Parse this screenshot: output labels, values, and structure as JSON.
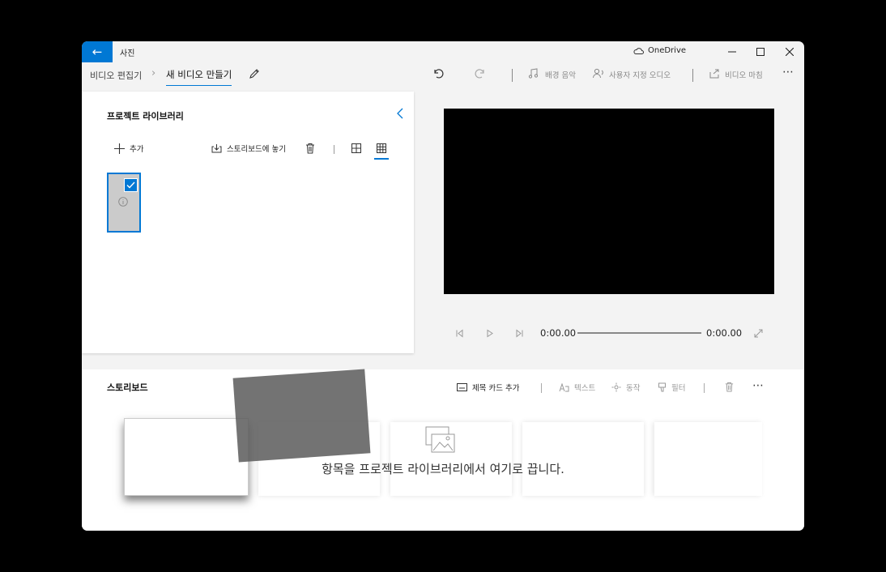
{
  "app": {
    "title": "사진",
    "onedrive_label": "OneDrive"
  },
  "icons": {
    "back": "back-arrow-icon",
    "onedrive": "cloud-icon",
    "minimize": "minimize-icon",
    "maximize": "maximize-icon",
    "close": "close-icon",
    "edit": "pencil-icon",
    "undo": "undo-icon",
    "redo": "redo-icon",
    "music": "music-note-icon",
    "custom_audio": "person-audio-icon",
    "finish": "share-icon",
    "more": "more-icon"
  },
  "breadcrumb": {
    "parent": "비디오 편집기",
    "current": "새 비디오 만들기"
  },
  "toolbar": {
    "background_music": "배경 음악",
    "custom_audio": "사용자 지정 오디오",
    "finish_video": "비디오 마침",
    "more": "⋯"
  },
  "library": {
    "title": "프로젝트 라이브러리",
    "add_label": "추가",
    "place_label": "스토리보드에 놓기"
  },
  "player": {
    "current_time": "0:00.00",
    "total_time": "0:00.00",
    "progress": 0
  },
  "storyboard": {
    "title": "스토리보드",
    "add_title_card": "제목 카드 추가",
    "text": "텍스트",
    "motion": "동작",
    "filters": "필터",
    "more": "⋯",
    "drop_message": "항목을 프로젝트 라이브러리에서 여기로 끕니다."
  },
  "colors": {
    "accent": "#0078d4",
    "window_bg": "#f3f3f3",
    "panel_bg": "#ffffff"
  }
}
